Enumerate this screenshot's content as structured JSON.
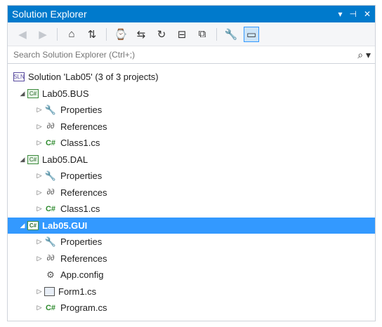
{
  "window": {
    "title": "Solution Explorer",
    "pin": "▾ ⊣ ✕"
  },
  "toolbar": {
    "buttons": [
      {
        "name": "back-icon",
        "glyph": "◀",
        "disabled": true
      },
      {
        "name": "forward-icon",
        "glyph": "▶",
        "disabled": true
      },
      {
        "name": "home-icon",
        "glyph": "⌂"
      },
      {
        "name": "switch-views-icon",
        "glyph": "⇅"
      },
      {
        "name": "pending-changes-icon",
        "glyph": "⌚"
      },
      {
        "name": "sync-icon",
        "glyph": "⇆"
      },
      {
        "name": "refresh-icon",
        "glyph": "↻"
      },
      {
        "name": "collapse-all-icon",
        "glyph": "⊟"
      },
      {
        "name": "show-all-files-icon",
        "glyph": "⧉"
      },
      {
        "name": "properties-icon",
        "glyph": "🔧"
      },
      {
        "name": "preview-icon",
        "glyph": "▭",
        "active": true
      }
    ]
  },
  "search": {
    "placeholder": "Search Solution Explorer (Ctrl+;)",
    "icon": "⌕ ▾"
  },
  "tree": [
    {
      "depth": 0,
      "arrow": "",
      "icon": "sol",
      "icon_text": "SLN",
      "label": "Solution 'Lab05' (3 of 3 projects)"
    },
    {
      "depth": 0,
      "arrow": "◢",
      "icon": "proj",
      "icon_text": "C#",
      "label": "Lab05.BUS"
    },
    {
      "depth": 1,
      "arrow": "▷",
      "icon": "wrench",
      "icon_text": "🔧",
      "label": "Properties"
    },
    {
      "depth": 1,
      "arrow": "▷",
      "icon": "ref",
      "icon_text": "∂∂",
      "label": "References"
    },
    {
      "depth": 1,
      "arrow": "▷",
      "icon": "cs",
      "icon_text": "C#",
      "label": "Class1.cs"
    },
    {
      "depth": 0,
      "arrow": "◢",
      "icon": "proj",
      "icon_text": "C#",
      "label": "Lab05.DAL"
    },
    {
      "depth": 1,
      "arrow": "▷",
      "icon": "wrench",
      "icon_text": "🔧",
      "label": "Properties"
    },
    {
      "depth": 1,
      "arrow": "▷",
      "icon": "ref",
      "icon_text": "∂∂",
      "label": "References"
    },
    {
      "depth": 1,
      "arrow": "▷",
      "icon": "cs",
      "icon_text": "C#",
      "label": "Class1.cs"
    },
    {
      "depth": 0,
      "arrow": "◢",
      "icon": "proj",
      "icon_text": "C#",
      "label": "Lab05.GUI",
      "selected": true
    },
    {
      "depth": 1,
      "arrow": "▷",
      "icon": "wrench",
      "icon_text": "🔧",
      "label": "Properties"
    },
    {
      "depth": 1,
      "arrow": "▷",
      "icon": "ref",
      "icon_text": "∂∂",
      "label": "References"
    },
    {
      "depth": 1,
      "arrow": "",
      "icon": "cfg",
      "icon_text": "⚙",
      "label": "App.config"
    },
    {
      "depth": 1,
      "arrow": "▷",
      "icon": "form",
      "icon_text": "",
      "label": "Form1.cs"
    },
    {
      "depth": 1,
      "arrow": "▷",
      "icon": "cs",
      "icon_text": "C#",
      "label": "Program.cs"
    }
  ],
  "colors": {
    "accent": "#007acc",
    "selection": "#3399ff"
  }
}
